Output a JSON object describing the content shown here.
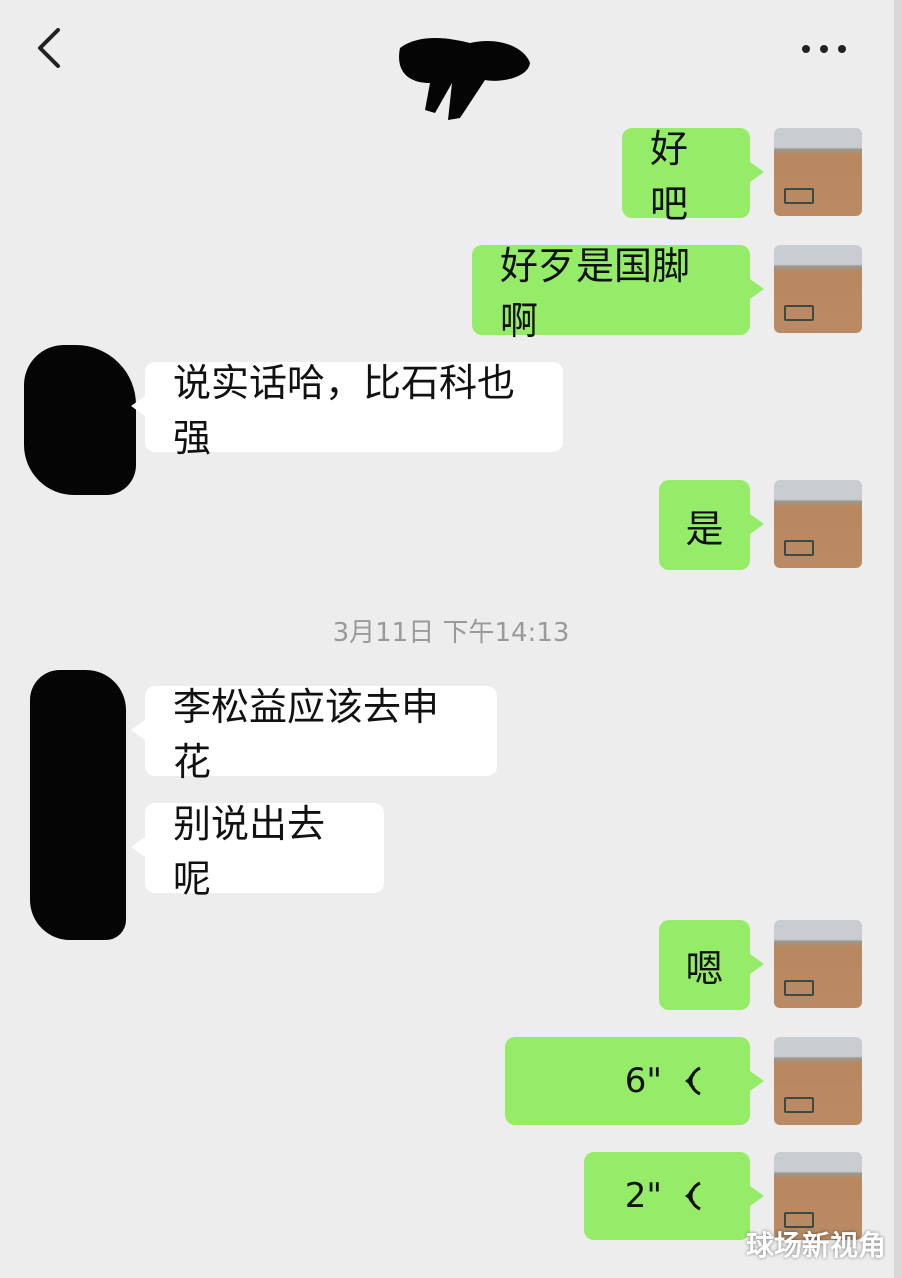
{
  "header": {
    "back_icon": "chevron-left-icon",
    "more_icon": "ellipsis-icon"
  },
  "messages": [
    {
      "side": "out",
      "text": "好吧"
    },
    {
      "side": "out",
      "text": "好歹是国脚啊"
    },
    {
      "side": "in",
      "text": "说实话哈，比石科也强"
    },
    {
      "side": "out",
      "text": "是"
    },
    {
      "side": "in",
      "text": "李松益应该去申花"
    },
    {
      "side": "in",
      "text": "别说出去呢"
    },
    {
      "side": "out",
      "text": "嗯"
    },
    {
      "side": "out",
      "type": "voice",
      "duration": "6\""
    },
    {
      "side": "out",
      "type": "voice",
      "duration": "2\""
    }
  ],
  "timestamp": "3月11日 下午14:13",
  "watermark": "球场新视角",
  "colors": {
    "background": "#ededed",
    "outgoing_bubble": "#95ec69",
    "incoming_bubble": "#ffffff",
    "timestamp": "#9a9a9a"
  }
}
